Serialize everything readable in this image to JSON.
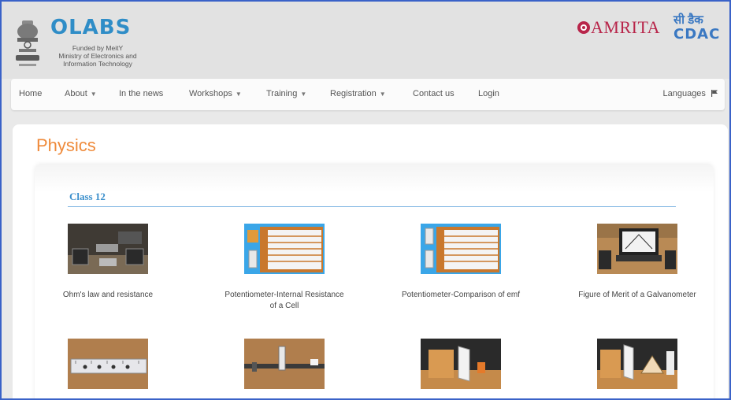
{
  "header": {
    "brand": "OLABS",
    "funded_by": "Funded by MeitY",
    "ministry": "Ministry of Electronics and Information Technology",
    "amrita": "AMRITA",
    "cdac_hindi": "सी डैक",
    "cdac": "CDAC"
  },
  "nav": {
    "items": [
      {
        "label": "Home",
        "dropdown": false
      },
      {
        "label": "About",
        "dropdown": true
      },
      {
        "label": "In the news",
        "dropdown": false
      },
      {
        "label": "Workshops",
        "dropdown": true
      },
      {
        "label": "Training",
        "dropdown": true
      },
      {
        "label": "Registration",
        "dropdown": true
      },
      {
        "label": "Contact us",
        "dropdown": false
      },
      {
        "label": "Login",
        "dropdown": false
      }
    ],
    "languages": "Languages"
  },
  "page": {
    "title": "Physics",
    "section": "Class 12"
  },
  "experiments": [
    {
      "title": "Ohm's law and resistance",
      "thumb": "ohms-law-thumbnail"
    },
    {
      "title": "Potentiometer-Internal Resistance of a Cell",
      "thumb": "potentiometer-internal-thumbnail"
    },
    {
      "title": "Potentiometer-Comparison of emf",
      "thumb": "potentiometer-emf-thumbnail"
    },
    {
      "title": "Figure of Merit of a Galvanometer",
      "thumb": "galvanometer-thumbnail"
    },
    {
      "title": "",
      "thumb": "meter-bridge-thumbnail"
    },
    {
      "title": "",
      "thumb": "optical-bench-thumbnail"
    },
    {
      "title": "",
      "thumb": "glass-slab-thumbnail"
    },
    {
      "title": "",
      "thumb": "prism-thumbnail"
    }
  ],
  "colors": {
    "brand_blue": "#2f8dc7",
    "title_orange": "#ef8a3a",
    "amrita_red": "#b8254a",
    "frame_blue": "#3a62c8"
  }
}
